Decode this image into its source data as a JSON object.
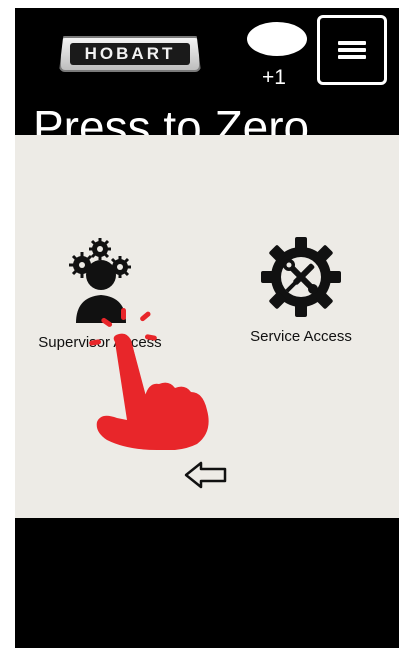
{
  "header": {
    "logo_text": "HOBART",
    "counter": "+1",
    "title": "Press to Zero"
  },
  "menu": {
    "icon": "hamburger-menu-icon"
  },
  "access_options": [
    {
      "label": "Supervisor Access",
      "icon": "supervisor-gears-person-icon"
    },
    {
      "label": "Service Access",
      "icon": "gear-wrench-screwdriver-icon"
    }
  ],
  "navigation": {
    "back_icon": "back-arrow-icon"
  },
  "overlay": {
    "hint_icon": "tap-hand-icon",
    "hint_color": "#e8262a"
  }
}
